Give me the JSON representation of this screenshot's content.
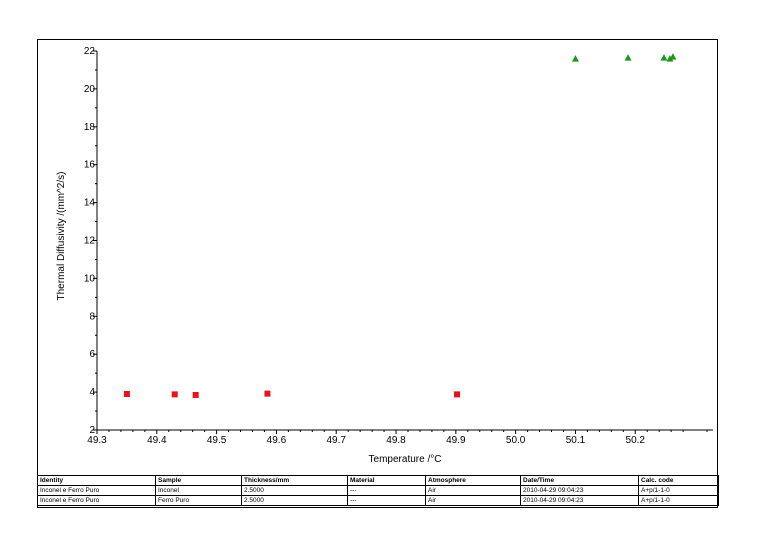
{
  "chart_data": {
    "type": "scatter",
    "title": "",
    "xlabel": "Temperature /°C",
    "ylabel": "Thermal Diffusivity /(mm^2/s)",
    "xlim": [
      49.3,
      50.33
    ],
    "ylim": [
      2,
      22
    ],
    "x_ticks": [
      49.3,
      49.4,
      49.5,
      49.6,
      49.7,
      49.8,
      49.9,
      50.0,
      50.1,
      50.2
    ],
    "y_ticks": [
      2,
      4,
      6,
      8,
      10,
      12,
      14,
      16,
      18,
      20,
      22
    ],
    "grid": false,
    "series": [
      {
        "color": "#e8121a",
        "marker": "square",
        "points": [
          [
            49.35,
            3.9
          ],
          [
            49.43,
            3.88
          ],
          [
            49.465,
            3.85
          ],
          [
            49.585,
            3.92
          ],
          [
            49.902,
            3.88
          ]
        ]
      },
      {
        "color": "#1a9a1a",
        "marker": "triangle",
        "points": [
          [
            50.1,
            21.6
          ],
          [
            50.188,
            21.65
          ],
          [
            50.248,
            21.65
          ],
          [
            50.258,
            21.6
          ],
          [
            50.263,
            21.7
          ]
        ]
      }
    ]
  },
  "info_table": {
    "headers": [
      "Identity",
      "Sample",
      "Thickness/mm",
      "Material",
      "Atmosphere",
      "Date/Time",
      "Calc. code"
    ],
    "rows": [
      [
        "Inconel e Ferro Puro",
        "Inconel",
        "2.5000",
        "---",
        "Air",
        "2010-04-29 09:04:23",
        "A+p/1-1-0"
      ],
      [
        "Inconel e Ferro Puro",
        "Ferro Puro",
        "2.5000",
        "---",
        "Air",
        "2010-04-29 09:04:23",
        "A+p/1-1-0"
      ]
    ]
  }
}
